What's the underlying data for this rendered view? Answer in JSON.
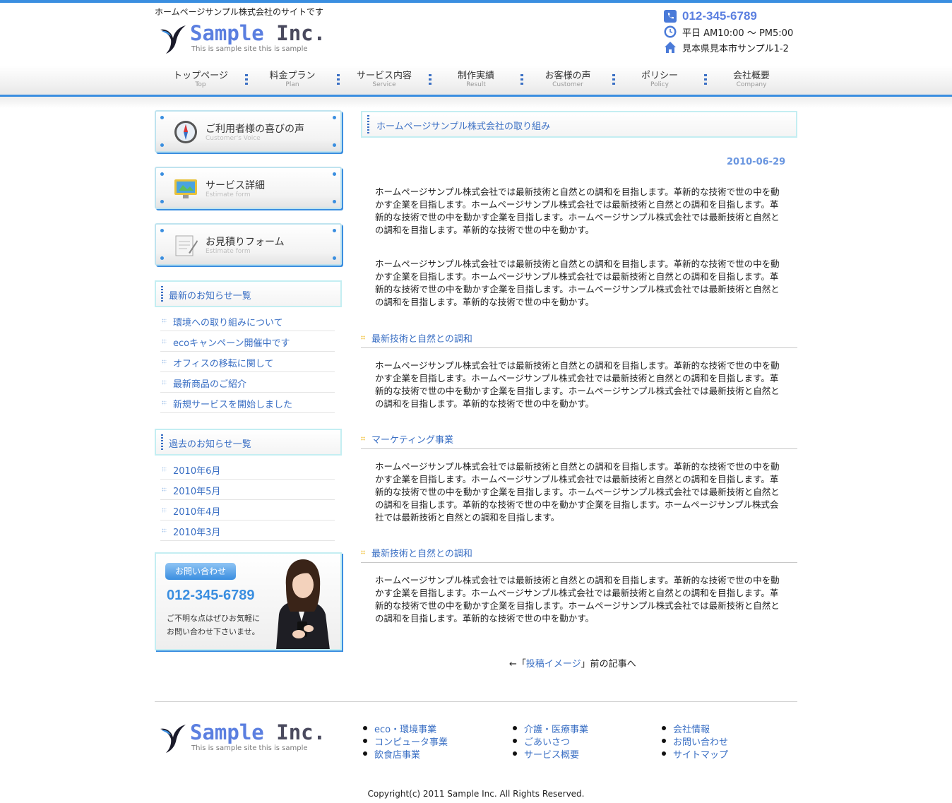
{
  "header": {
    "tagline": "ホームページサンプル株式会社のサイトです",
    "logo_name_a": "Sample",
    "logo_name_b": "Inc.",
    "logo_sub": "This is sample site this is sample",
    "phone": "012-345-6789",
    "hours": "平日 AM10:00 ～ PM5:00",
    "address": "見本県見本市サンプル1-2"
  },
  "nav": [
    {
      "jp": "トップページ",
      "en": "Top"
    },
    {
      "jp": "料金プラン",
      "en": "Plan"
    },
    {
      "jp": "サービス内容",
      "en": "Service"
    },
    {
      "jp": "制作実績",
      "en": "Result"
    },
    {
      "jp": "お客様の声",
      "en": "Customer"
    },
    {
      "jp": "ポリシー",
      "en": "Policy"
    },
    {
      "jp": "会社概要",
      "en": "Company"
    }
  ],
  "sidebar": {
    "buttons": [
      {
        "jp": "ご利用者様の喜びの声",
        "en": "Customer's Voice",
        "icon": "compass-icon"
      },
      {
        "jp": "サービス詳細",
        "en": "Estimate form",
        "icon": "monitor-icon"
      },
      {
        "jp": "お見積りフォーム",
        "en": "Estimate form",
        "icon": "form-icon"
      }
    ],
    "latest_title": "最新のお知らせ一覧",
    "latest": [
      "環境への取り組みについて",
      "ecoキャンペーン開催中です",
      "オフィスの移転に関して",
      "最新商品のご紹介",
      "新規サービスを開始しました"
    ],
    "past_title": "過去のお知らせ一覧",
    "past": [
      "2010年6月",
      "2010年5月",
      "2010年4月",
      "2010年3月"
    ],
    "contact": {
      "badge": "お問い合わせ",
      "phone": "012-345-6789",
      "note1": "ご不明な点はぜひお気軽に",
      "note2": "お問い合わせ下さいませ。"
    }
  },
  "main": {
    "title": "ホームページサンプル株式会社の取り組み",
    "date": "2010-06-29",
    "p1": "ホームページサンプル株式会社では最新技術と自然との調和を目指します。革新的な技術で世の中を動かす企業を目指します。ホームページサンプル株式会社では最新技術と自然との調和を目指します。革新的な技術で世の中を動かす企業を目指します。ホームページサンプル株式会社では最新技術と自然との調和を目指します。革新的な技術で世の中を動かす。",
    "p2": "ホームページサンプル株式会社では最新技術と自然との調和を目指します。革新的な技術で世の中を動かす企業を目指します。ホームページサンプル株式会社では最新技術と自然との調和を目指します。革新的な技術で世の中を動かす企業を目指します。ホームページサンプル株式会社では最新技術と自然との調和を目指します。革新的な技術で世の中を動かす。",
    "sec1_title": "最新技術と自然との調和",
    "sec1_text": "ホームページサンプル株式会社では最新技術と自然との調和を目指します。革新的な技術で世の中を動かす企業を目指します。ホームページサンプル株式会社では最新技術と自然との調和を目指します。革新的な技術で世の中を動かす企業を目指します。ホームページサンプル株式会社では最新技術と自然との調和を目指します。革新的な技術で世の中を動かす。",
    "sec2_title": "マーケティング事業",
    "sec2_text": "ホームページサンプル株式会社では最新技術と自然との調和を目指します。革新的な技術で世の中を動かす企業を目指します。ホームページサンプル株式会社では最新技術と自然との調和を目指します。革新的な技術で世の中を動かす企業を目指します。ホームページサンプル株式会社では最新技術と自然との調和を目指します。革新的な技術で世の中を動かす企業を目指します。ホームページサンプル株式会社では最新技術と自然との調和を目指します。",
    "sec3_title": "最新技術と自然との調和",
    "sec3_text": "ホームページサンプル株式会社では最新技術と自然との調和を目指します。革新的な技術で世の中を動かす企業を目指します。ホームページサンプル株式会社では最新技術と自然との調和を目指します。革新的な技術で世の中を動かす企業を目指します。ホームページサンプル株式会社では最新技術と自然との調和を目指します。革新的な技術で世の中を動かす。",
    "prev_before": "←「",
    "prev_link": "投稿イメージ",
    "prev_after": "」前の記事へ"
  },
  "footer": {
    "col1": [
      "eco・環境事業",
      "コンピュータ事業",
      "飲食店事業"
    ],
    "col2": [
      "介護・医療事業",
      "ごあいさつ",
      "サービス概要"
    ],
    "col3": [
      "会社情報",
      "お問い合わせ",
      "サイトマップ"
    ],
    "copyright": "Copyright(c) 2011 Sample Inc. All Rights Reserved."
  },
  "colors": {
    "accent": "#3a8ee0",
    "link": "#3a6fc4",
    "logo": "#5b7fe0"
  }
}
